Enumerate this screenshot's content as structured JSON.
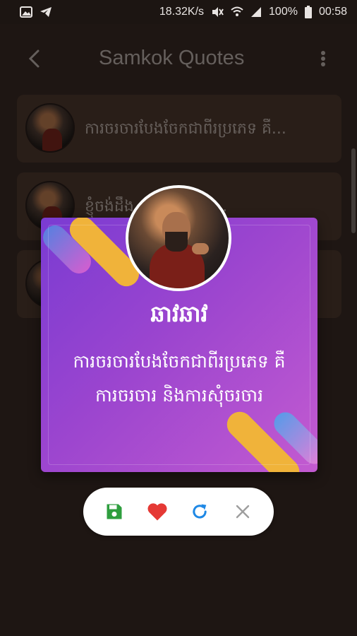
{
  "status_bar": {
    "speed": "18.32K/s",
    "battery": "100%",
    "time": "00:58"
  },
  "app_bar": {
    "title": "Samkok Quotes"
  },
  "list": {
    "items": [
      {
        "text": "ការចរចារបែងចែកជាពីរប្រភេទ គឺ..."
      },
      {
        "text": "ខ្ញុំចង់ដឹង បើមានសត្រូវ..."
      },
      {
        "text": ""
      }
    ]
  },
  "dialog": {
    "name": "ឆាវឆាវ",
    "quote": "ការចរចារបែងចែកជាពីរប្រភេទ គឺការចរចារ និងការសុំចរចារ"
  },
  "actions": {
    "save_color": "#2e9e3e",
    "like_color": "#e53935",
    "refresh_color": "#1e88e5",
    "close_color": "#9e9e9e"
  },
  "colors": {
    "background": "#2a1f1b",
    "card_gradient_start": "#7a3bd2",
    "card_gradient_end": "#c35bd0",
    "stripe_yellow": "#f0b33a"
  }
}
